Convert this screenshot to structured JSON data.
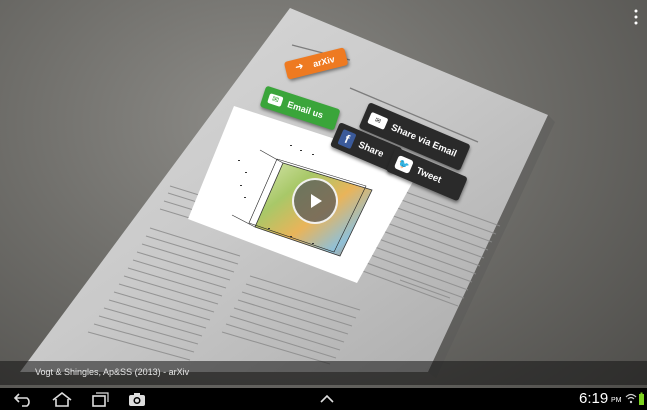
{
  "overlay_buttons": {
    "arxiv": "arXiv",
    "email_us": "Email us",
    "share_via_email": "Share via Email",
    "share": "Share",
    "tweet": "Tweet"
  },
  "caption": "Vogt & Shingles, Ap&SS (2013) - arXiv",
  "status_bar": {
    "time": "6:19",
    "ampm": "PM"
  },
  "icons": {
    "arxiv": "arrow-right-icon",
    "email_us": "envelope-icon",
    "share_via_email": "mail-icon",
    "share": "facebook-icon",
    "tweet": "twitter-bird-icon",
    "play": "play-icon",
    "overflow": "overflow-menu-icon",
    "nav": [
      "back-icon",
      "home-icon",
      "recent-apps-icon",
      "camera-icon",
      "chevron-up-icon"
    ]
  },
  "colors": {
    "arxiv_button": "#ee7a21",
    "email_us_button": "#3aa53a",
    "share_buttons": "#2a2a2a",
    "facebook": "#3b5a9a",
    "battery": "#7ed321"
  }
}
